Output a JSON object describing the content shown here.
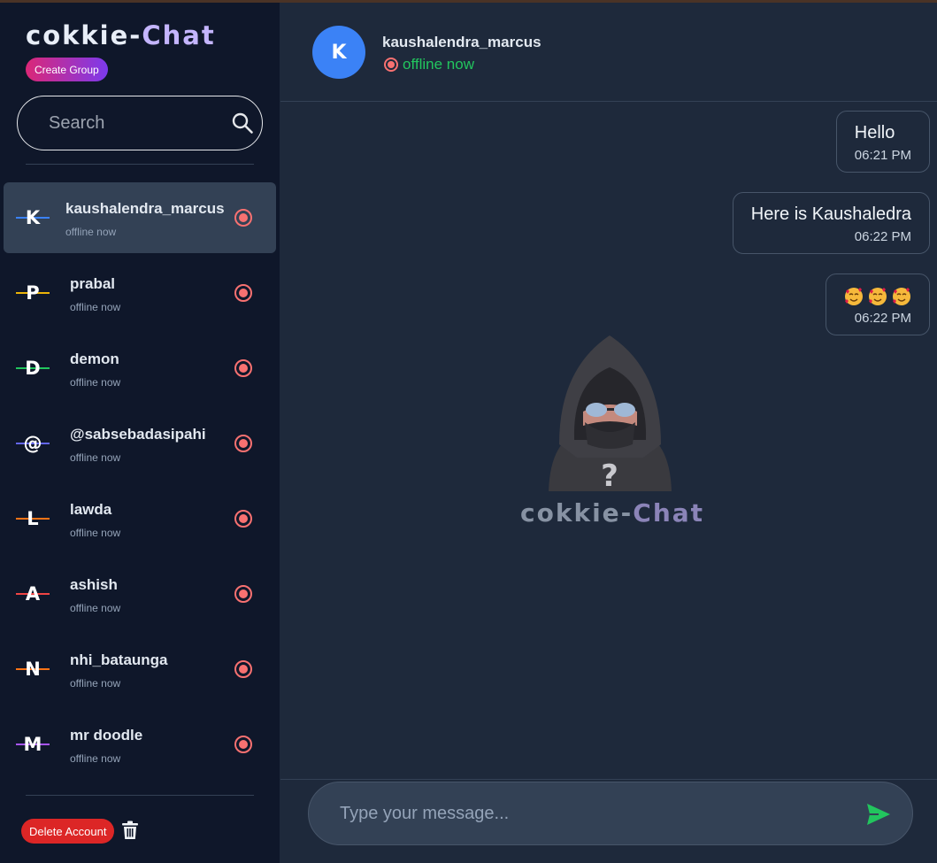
{
  "sidebar": {
    "brand_main": "cokkie-",
    "brand_accent": "Chat",
    "create_group_label": "Create Group",
    "search_placeholder": "Search",
    "contacts": [
      {
        "initial": "K",
        "name": "kaushalendra_marcus",
        "status": "offline now",
        "line_color": "#3b82f6",
        "active": true
      },
      {
        "initial": "P",
        "name": "prabal",
        "status": "offline now",
        "line_color": "#eab308",
        "active": false
      },
      {
        "initial": "D",
        "name": "demon",
        "status": "offline now",
        "line_color": "#22c55e",
        "active": false
      },
      {
        "initial": "@",
        "name": "@sabsebadasipahi",
        "status": "offline now",
        "line_color": "#6366f1",
        "active": false
      },
      {
        "initial": "L",
        "name": "lawda",
        "status": "offline now",
        "line_color": "#f97316",
        "active": false
      },
      {
        "initial": "A",
        "name": "ashish",
        "status": "offline now",
        "line_color": "#ef4444",
        "active": false
      },
      {
        "initial": "N",
        "name": "nhi_bataunga",
        "status": "offline now",
        "line_color": "#f97316",
        "active": false
      },
      {
        "initial": "M",
        "name": "mr doodle",
        "status": "offline now",
        "line_color": "#a855f7",
        "active": false
      }
    ],
    "delete_account_label": "Delete Account"
  },
  "chat": {
    "header": {
      "initial": "K",
      "name": "kaushalendra_marcus",
      "status": "offline now"
    },
    "messages": [
      {
        "text": "Hello",
        "time": "06:21 PM"
      },
      {
        "text": "Here is Kaushaledra",
        "time": "06:22 PM"
      },
      {
        "text": "🥰 🥰 🥰",
        "time": "06:22 PM"
      }
    ],
    "watermark_main": "cokkie-",
    "watermark_accent": "Chat",
    "composer_placeholder": "Type your message..."
  },
  "colors": {
    "accent_blue": "#3b82f6",
    "offline_red": "#f87171",
    "status_green": "#22c55e",
    "delete_red": "#dc2626"
  },
  "icons": {
    "search": "search-icon",
    "status": "offline-indicator-icon",
    "trash": "trash-icon",
    "send": "send-icon",
    "emoji": "smiling-face-with-hearts-icon",
    "placeholder_figure": "anonymous-hacker-icon"
  }
}
